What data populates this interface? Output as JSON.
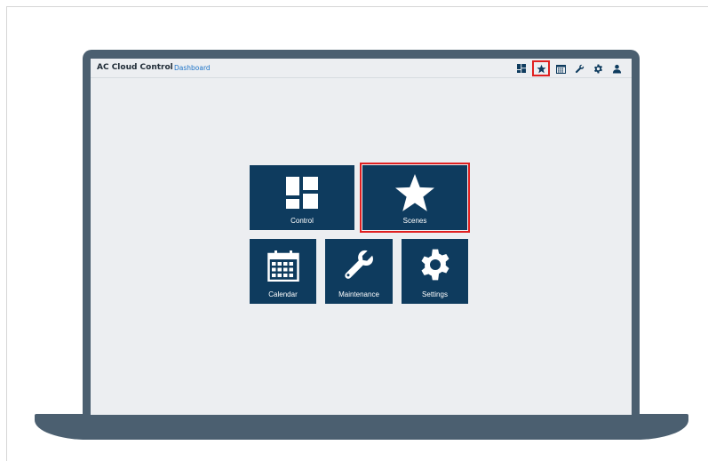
{
  "app": {
    "title": "AC Cloud Control",
    "separator": "-",
    "breadcrumb": "Dashboard"
  },
  "toolbar": {
    "icons": [
      "control-icon",
      "scenes-icon",
      "calendar-icon",
      "maintenance-icon",
      "settings-icon",
      "user-icon"
    ],
    "selected": "scenes-icon"
  },
  "tiles": {
    "control": {
      "label": "Control",
      "icon": "control-icon"
    },
    "scenes": {
      "label": "Scenes",
      "icon": "star-icon",
      "selected": true
    },
    "calendar": {
      "label": "Calendar",
      "icon": "calendar-icon"
    },
    "maintenance": {
      "label": "Maintenance",
      "icon": "wrench-icon"
    },
    "settings": {
      "label": "Settings",
      "icon": "gear-icon"
    }
  },
  "colors": {
    "tile": "#0e3b5e",
    "highlight": "#e02020",
    "laptop": "#4b5f70",
    "screen": "#eceef1",
    "link": "#1e74c8"
  }
}
